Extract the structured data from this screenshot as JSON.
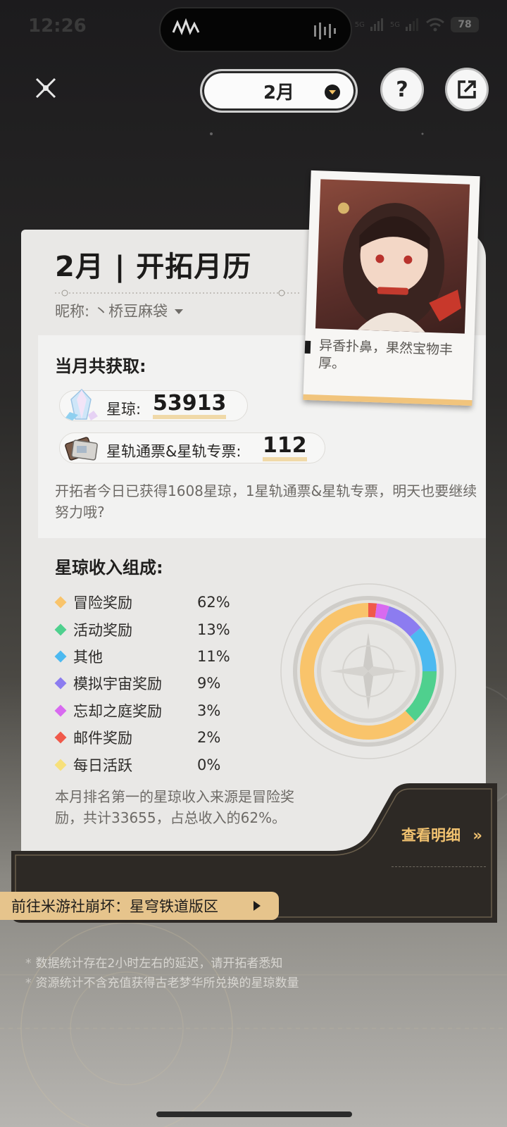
{
  "status_bar": {
    "time": "12:26",
    "signal_1": "5G",
    "signal_2": "5G",
    "battery": "78"
  },
  "header": {
    "month_selected": "2月",
    "help_label": "?"
  },
  "card": {
    "title": "2月 | 开拓月历",
    "nickname_label": "昵称:",
    "nickname_value": "丶桥豆麻袋"
  },
  "photo": {
    "caption": "异香扑鼻，果然宝物丰厚。"
  },
  "totals": {
    "title": "当月共获取:",
    "stellar_jade_label": "星琼:",
    "stellar_jade_value": "53913",
    "pass_label": "星轨通票&星轨专票:",
    "pass_value": "112",
    "note": "开拓者今日已获得1608星琼，1星轨通票&星轨专票，明天也要继续努力哦?"
  },
  "composition": {
    "title": "星琼收入组成:",
    "items": [
      {
        "name": "冒险奖励",
        "pct": "62%",
        "color": "#f9c46b"
      },
      {
        "name": "活动奖励",
        "pct": "13%",
        "color": "#4fd08e"
      },
      {
        "name": "其他",
        "pct": "11%",
        "color": "#4cb9f0"
      },
      {
        "name": "模拟宇宙奖励",
        "pct": "9%",
        "color": "#8c7cf0"
      },
      {
        "name": "忘却之庭奖励",
        "pct": "3%",
        "color": "#d86af0"
      },
      {
        "name": "邮件奖励",
        "pct": "2%",
        "color": "#f0594a"
      },
      {
        "name": "每日活跃",
        "pct": "0%",
        "color": "#f7e07a"
      }
    ],
    "summary": "本月排名第一的星琼收入来源是冒险奖励，共计33655，占总收入的62%。"
  },
  "detail_button": {
    "label": "查看明细",
    "arrow": "»"
  },
  "forum_button": {
    "label": "前往米游社崩坏：星穹铁道版区"
  },
  "notes": [
    "数据统计存在2小时左右的延迟，请开拓者悉知",
    "资源统计不含充值获得古老梦华所兑换的星琼数量"
  ]
}
